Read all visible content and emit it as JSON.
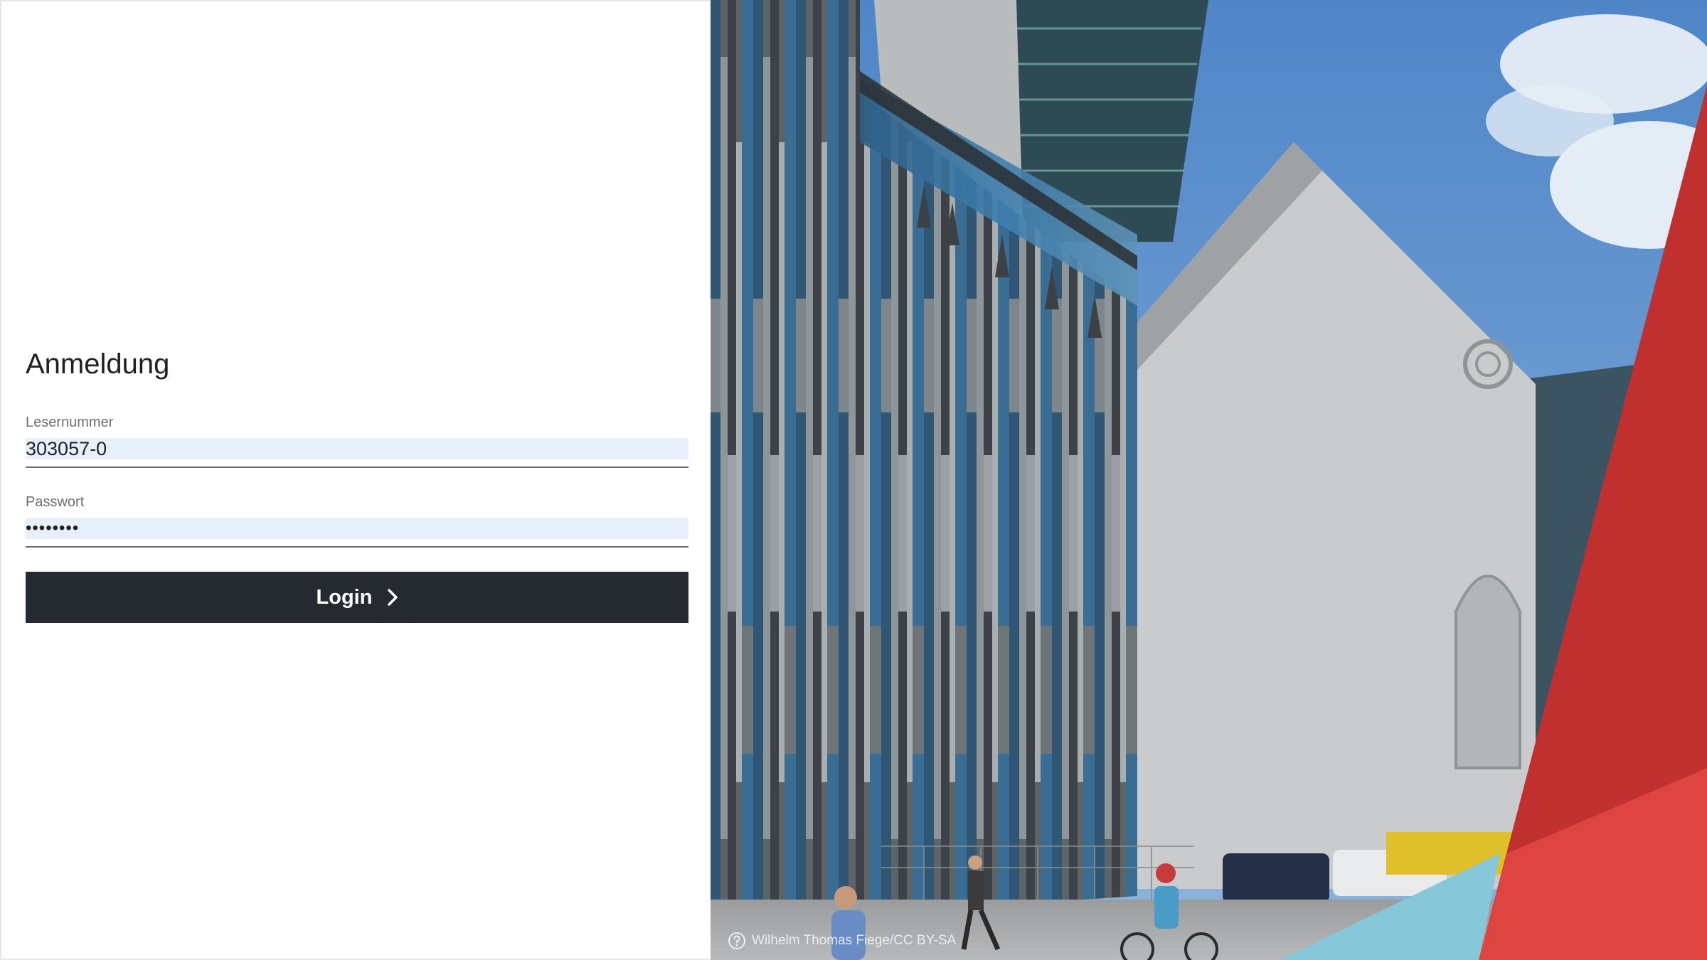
{
  "login": {
    "title": "Anmeldung",
    "reader_number": {
      "label": "Lesernummer",
      "value": "303057-0"
    },
    "password": {
      "label": "Passwort",
      "value": "********"
    },
    "submit_label": "Login",
    "submit_icon": "chevron-right-icon"
  },
  "hero": {
    "credit": "Wilhelm Thomas Fiege/CC BY-SA",
    "credit_icon": "help-circle-icon"
  },
  "colors": {
    "button": "#252a31",
    "input_autofill": "#e8f0fe",
    "accent_red": "#c8302f",
    "accent_red_light": "#e04541",
    "accent_blue": "#7fc4d8"
  }
}
